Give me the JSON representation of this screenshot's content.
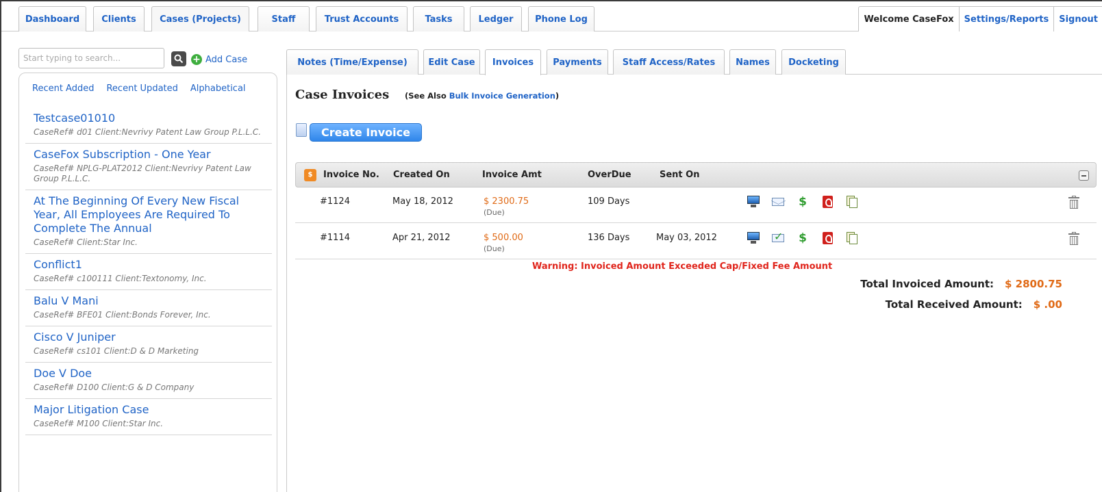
{
  "topnav": {
    "tabs": [
      "Dashboard",
      "Clients",
      "Cases (Projects)",
      "Staff",
      "Trust Accounts",
      "Tasks",
      "Ledger",
      "Phone Log"
    ],
    "welcome": "Welcome CaseFox",
    "settings": "Settings/Reports",
    "signout": "Signout"
  },
  "sidebar": {
    "search_placeholder": "Start typing to search...",
    "add_case": "Add Case",
    "sort_links": [
      "Recent Added",
      "Recent Updated",
      "Alphabetical"
    ],
    "cases": [
      {
        "title": "Testcase01010",
        "meta": "CaseRef# d01 Client:Nevrivy Patent Law Group P.L.L.C."
      },
      {
        "title": "CaseFox Subscription - One Year",
        "meta": "CaseRef# NPLG-PLAT2012 Client:Nevrivy Patent Law Group P.L.L.C."
      },
      {
        "title": "At The Beginning Of Every New Fiscal Year, All Employees Are Required To Complete The Annual",
        "meta": "CaseRef# Client:Star Inc."
      },
      {
        "title": "Conflict1",
        "meta": "CaseRef# c100111 Client:Textonomy, Inc."
      },
      {
        "title": "Balu V Mani",
        "meta": "CaseRef# BFE01 Client:Bonds Forever, Inc."
      },
      {
        "title": "Cisco V Juniper",
        "meta": "CaseRef# cs101 Client:D & D Marketing"
      },
      {
        "title": "Doe V Doe",
        "meta": "CaseRef# D100 Client:G & D Company"
      },
      {
        "title": "Major Litigation Case",
        "meta": "CaseRef# M100 Client:Star Inc."
      }
    ]
  },
  "subtabs": [
    "Notes (Time/Expense)",
    "Edit Case",
    "Invoices",
    "Payments",
    "Staff Access/Rates",
    "Names",
    "Docketing"
  ],
  "main": {
    "title": "Case Invoices",
    "see_also_prefix": "(See Also ",
    "see_also_link": "Bulk Invoice Generation",
    "see_also_suffix": ")",
    "create_invoice": "Create Invoice",
    "columns": [
      "Invoice No.",
      "Created On",
      "Invoice Amt",
      "OverDue",
      "Sent On"
    ],
    "invoices": [
      {
        "no": "#1124",
        "created": "May 18, 2012",
        "amount": "$ 2300.75",
        "status": "(Due)",
        "overdue": "109 Days",
        "sent": ""
      },
      {
        "no": "#1114",
        "created": "Apr 21, 2012",
        "amount": "$ 500.00",
        "status": "(Due)",
        "overdue": "136 Days",
        "sent": "May 03, 2012"
      }
    ],
    "warning": "Warning: Invoiced Amount Exceeded Cap/Fixed Fee Amount",
    "total_invoiced_label": "Total Invoiced Amount:",
    "total_invoiced_value": "$ 2800.75",
    "total_received_label": "Total Received Amount:",
    "total_received_value": "$ .00"
  },
  "colors": {
    "link": "#1f63c6",
    "amount": "#e06a16",
    "warning": "#e0251c"
  }
}
